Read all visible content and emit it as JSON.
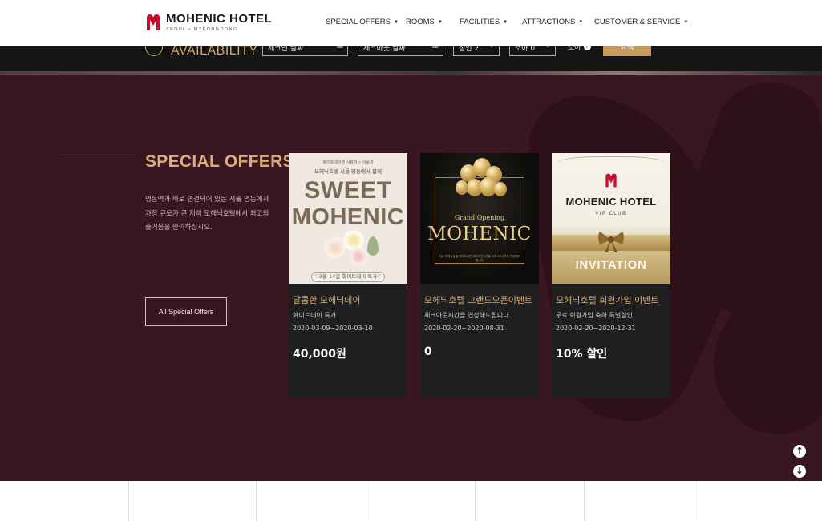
{
  "header": {
    "logo_title": "MOHENIC HOTEL",
    "logo_subtitle": "SEOUL • MYEONGDONG",
    "nav": [
      {
        "label": "SPECIAL OFFERS"
      },
      {
        "label": "ROOMS"
      },
      {
        "label": "FACILITIES"
      },
      {
        "label": "ATTRACTIONS"
      },
      {
        "label": "CUSTOMER & SERVICE"
      }
    ]
  },
  "availability": {
    "label": "AVAILABILITY",
    "checkin_placeholder": "체크인 날짜",
    "checkout_placeholder": "체크아웃 날짜",
    "adults": "성인 2",
    "children": "소아 0",
    "child_help": "소아",
    "search_label": "검색"
  },
  "offers": {
    "title": "SPECIAL OFFERS",
    "description": "명동역과 바로 연결되어 있는 서울 명동에서 가장 규모가 큰 저희 모헤닉호텔에서 최고의 즐거움을 만끽하십시오.",
    "all_button": "All Special Offers",
    "cards": [
      {
        "title": "달콤한 모헤닉데이",
        "subtitle": "화이트데이 특가",
        "dates": "2020-03-09~2020-03-10",
        "price": "40,000원",
        "image": {
          "line1": "화이트데이엔 사랑하는 사람과",
          "line2": "모헤닉호텔 서울 명동에서 함께",
          "word1": "SWEET",
          "word2": "MOHENIC",
          "footer": "♡3월 14일 화이트데이 특가♡"
        }
      },
      {
        "title": "모헤닉호텔 그랜드오픈이벤트",
        "subtitle": "체크아웃시간을 연장해드립니다.",
        "dates": "2020-02-20~2020-08-31",
        "price": "0",
        "image": {
          "line1": "Grand Opening",
          "word1": "MOHENIC",
          "small": "지금 모헤닉호텔 예약하시면 체크아웃시간을 오후 12시까지 연장해드립니다"
        }
      },
      {
        "title": "모헤닉호텔 회원가입 이벤트",
        "subtitle": "무료 회원가입 축하 특별할인",
        "dates": "2020-02-20~2020-12-31",
        "price": "10% 할인",
        "image": {
          "name": "MOHENIC HOTEL",
          "club": "VIP CLUB",
          "word1": "INVITATION"
        }
      }
    ]
  },
  "scroll": {
    "up": "↑",
    "down": "↓"
  },
  "colors": {
    "accent": "#d9ad79",
    "section_bg": "#3a1720",
    "card_bg": "#1f1f1f",
    "brand_red": "#c8102e"
  }
}
